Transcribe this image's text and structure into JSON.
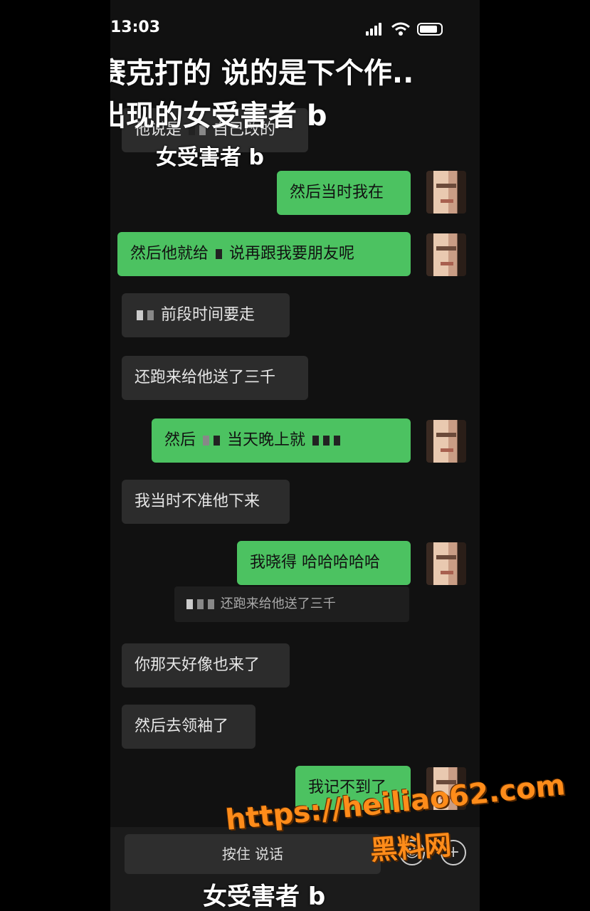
{
  "status": {
    "time": "13:03"
  },
  "overlay": {
    "line1": "赛克打的 说的是下个作..",
    "line2": "出现的女受害者 b",
    "line3": "女受害者 b",
    "bottom": "女受害者 b"
  },
  "messages": {
    "m0": "他说是",
    "m0b": "自己改的",
    "m1": "然后当时我在",
    "m2a": "然后他就给",
    "m2b": "说再跟我要朋友呢",
    "m3": "前段时间要走",
    "m4": "还跑来给他送了三千",
    "m5a": "然后",
    "m5b": "当天晚上就",
    "m6": "我当时不准他下来",
    "m7": "我晓得 哈哈哈哈哈",
    "m7_quote": "还跑来给他送了三千",
    "m8": "你那天好像也来了",
    "m9": "然后去领袖了",
    "m10": "我记不到了"
  },
  "input": {
    "hold_label": "按住 说话",
    "plus": "+"
  },
  "watermark": {
    "url": "https://heiliao62.com",
    "name": "黑料网",
    "color": "#ff8c1a"
  }
}
